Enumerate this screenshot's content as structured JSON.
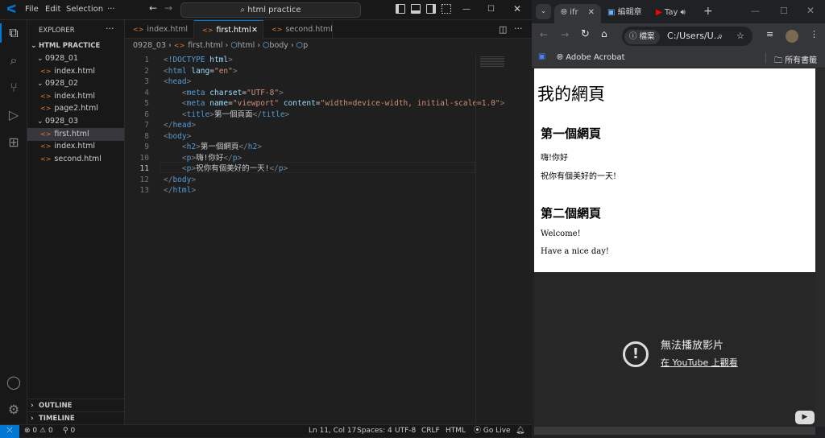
{
  "vscode": {
    "menu": [
      "File",
      "Edit",
      "Selection",
      "···"
    ],
    "search": "html practice",
    "explorer": {
      "title": "EXPLORER",
      "root": "HTML PRACTICE",
      "items": [
        {
          "label": "0928_01",
          "type": "folder"
        },
        {
          "label": "index.html",
          "type": "file"
        },
        {
          "label": "0928_02",
          "type": "folder"
        },
        {
          "label": "index.html",
          "type": "file"
        },
        {
          "label": "page2.html",
          "type": "file"
        },
        {
          "label": "0928_03",
          "type": "folder"
        },
        {
          "label": "first.html",
          "type": "file",
          "selected": true
        },
        {
          "label": "index.html",
          "type": "file"
        },
        {
          "label": "second.html",
          "type": "file"
        }
      ],
      "outline": "OUTLINE",
      "timeline": "TIMELINE"
    },
    "tabs": [
      {
        "label": "index.html"
      },
      {
        "label": "first.html",
        "active": true
      },
      {
        "label": "second.html"
      }
    ],
    "breadcrumbs": [
      "0928_03",
      "first.html",
      "html",
      "body",
      "p"
    ],
    "code": [
      [
        [
          "punc",
          "<"
        ],
        [
          "doc",
          "!DOCTYPE"
        ],
        [
          "text",
          " "
        ],
        [
          "attr",
          "html"
        ],
        [
          "punc",
          ">"
        ]
      ],
      [
        [
          "punc",
          "<"
        ],
        [
          "tag",
          "html"
        ],
        [
          "text",
          " "
        ],
        [
          "attr",
          "lang"
        ],
        [
          "text",
          "="
        ],
        [
          "str",
          "\"en\""
        ],
        [
          "punc",
          ">"
        ]
      ],
      [
        [
          "punc",
          "<"
        ],
        [
          "tag",
          "head"
        ],
        [
          "punc",
          ">"
        ]
      ],
      [
        [
          "text",
          "    "
        ],
        [
          "punc",
          "<"
        ],
        [
          "tag",
          "meta"
        ],
        [
          "text",
          " "
        ],
        [
          "attr",
          "charset"
        ],
        [
          "text",
          "="
        ],
        [
          "str",
          "\"UTF-8\""
        ],
        [
          "punc",
          ">"
        ]
      ],
      [
        [
          "text",
          "    "
        ],
        [
          "punc",
          "<"
        ],
        [
          "tag",
          "meta"
        ],
        [
          "text",
          " "
        ],
        [
          "attr",
          "name"
        ],
        [
          "text",
          "="
        ],
        [
          "str",
          "\"viewport\""
        ],
        [
          "text",
          " "
        ],
        [
          "attr",
          "content"
        ],
        [
          "text",
          "="
        ],
        [
          "str",
          "\"width=device-width, initial-scale=1.0\""
        ],
        [
          "punc",
          ">"
        ]
      ],
      [
        [
          "text",
          "    "
        ],
        [
          "punc",
          "<"
        ],
        [
          "tag",
          "title"
        ],
        [
          "punc",
          ">"
        ],
        [
          "text",
          "第一個頁面"
        ],
        [
          "punc",
          "</"
        ],
        [
          "tag",
          "title"
        ],
        [
          "punc",
          ">"
        ]
      ],
      [
        [
          "punc",
          "</"
        ],
        [
          "tag",
          "head"
        ],
        [
          "punc",
          ">"
        ]
      ],
      [
        [
          "punc",
          "<"
        ],
        [
          "tag",
          "body"
        ],
        [
          "punc",
          ">"
        ]
      ],
      [
        [
          "text",
          "    "
        ],
        [
          "punc",
          "<"
        ],
        [
          "tag",
          "h2"
        ],
        [
          "punc",
          ">"
        ],
        [
          "text",
          "第一個網頁"
        ],
        [
          "punc",
          "</"
        ],
        [
          "tag",
          "h2"
        ],
        [
          "punc",
          ">"
        ]
      ],
      [
        [
          "text",
          "    "
        ],
        [
          "punc",
          "<"
        ],
        [
          "tag",
          "p"
        ],
        [
          "punc",
          ">"
        ],
        [
          "text",
          "嗨!你好"
        ],
        [
          "punc",
          "</"
        ],
        [
          "tag",
          "p"
        ],
        [
          "punc",
          ">"
        ]
      ],
      [
        [
          "text",
          "    "
        ],
        [
          "punc",
          "<"
        ],
        [
          "tag",
          "p"
        ],
        [
          "punc",
          ">"
        ],
        [
          "text",
          "祝你有個美好的一天!"
        ],
        [
          "punc",
          "</"
        ],
        [
          "tag",
          "p"
        ],
        [
          "punc",
          ">"
        ]
      ],
      [
        [
          "punc",
          "</"
        ],
        [
          "tag",
          "body"
        ],
        [
          "punc",
          ">"
        ]
      ],
      [
        [
          "punc",
          "</"
        ],
        [
          "tag",
          "html"
        ],
        [
          "punc",
          ">"
        ]
      ]
    ],
    "current_line": 11,
    "status": {
      "errors": "0",
      "warnings": "0",
      "ports": "0",
      "position": "Ln 11, Col 17",
      "spaces": "Spaces: 4",
      "encoding": "UTF-8",
      "eol": "CRLF",
      "language": "HTML",
      "golive": "Go Live"
    }
  },
  "browser": {
    "tabs": [
      {
        "label": "ifr",
        "active": true
      },
      {
        "label": "編輯章"
      },
      {
        "label": "Tay"
      }
    ],
    "site_info": "檔案",
    "url": "C:/Users/U...",
    "bookmarks": [
      "Adobe Acrobat"
    ],
    "all_bookmarks": "所有書籤",
    "page": {
      "h1": "我的網頁",
      "sections": [
        {
          "h2": "第一個網頁",
          "p": [
            "嗨!你好",
            "祝你有個美好的一天!"
          ]
        },
        {
          "h2": "第二個網頁",
          "p": [
            "Welcome!",
            "Have a nice day!"
          ]
        }
      ]
    },
    "video": {
      "message": "無法播放影片",
      "link": "在 YouTube 上觀看"
    }
  }
}
